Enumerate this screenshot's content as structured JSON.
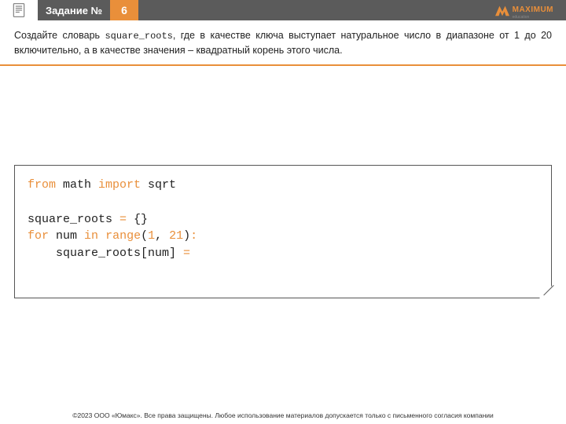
{
  "header": {
    "task_label": "Задание №",
    "task_number": "6",
    "logo_text": "MAXIMUM",
    "logo_sub": "education"
  },
  "task_description": {
    "pre": "Создайте словарь ",
    "identifier": "square_roots",
    "post": ", где в качестве ключа выступает натуральное число в диапазоне от 1 до 20 включительно, а в качестве значения – квадратный корень этого числа."
  },
  "code": {
    "l1_kw1": "from",
    "l1_txt1": " math ",
    "l1_kw2": "import",
    "l1_txt2": " sqrt",
    "l3_txt1": "square_roots ",
    "l3_op": "=",
    "l3_txt2": " {}",
    "l4_kw1": "for",
    "l4_txt1": " num ",
    "l4_kw2": "in",
    "l4_txt2": " ",
    "l4_kw3": "range",
    "l4_paren1": "(",
    "l4_n1": "1",
    "l4_comma": ", ",
    "l4_n2": "21",
    "l4_paren2": ")",
    "l4_colon": ":",
    "l5_indent": "    ",
    "l5_txt1": "square_roots[num] ",
    "l5_op": "="
  },
  "footer": "©2023 ООО «Юмакс». Все права защищены. Любое использование материалов допускается только с письменного согласия компании"
}
